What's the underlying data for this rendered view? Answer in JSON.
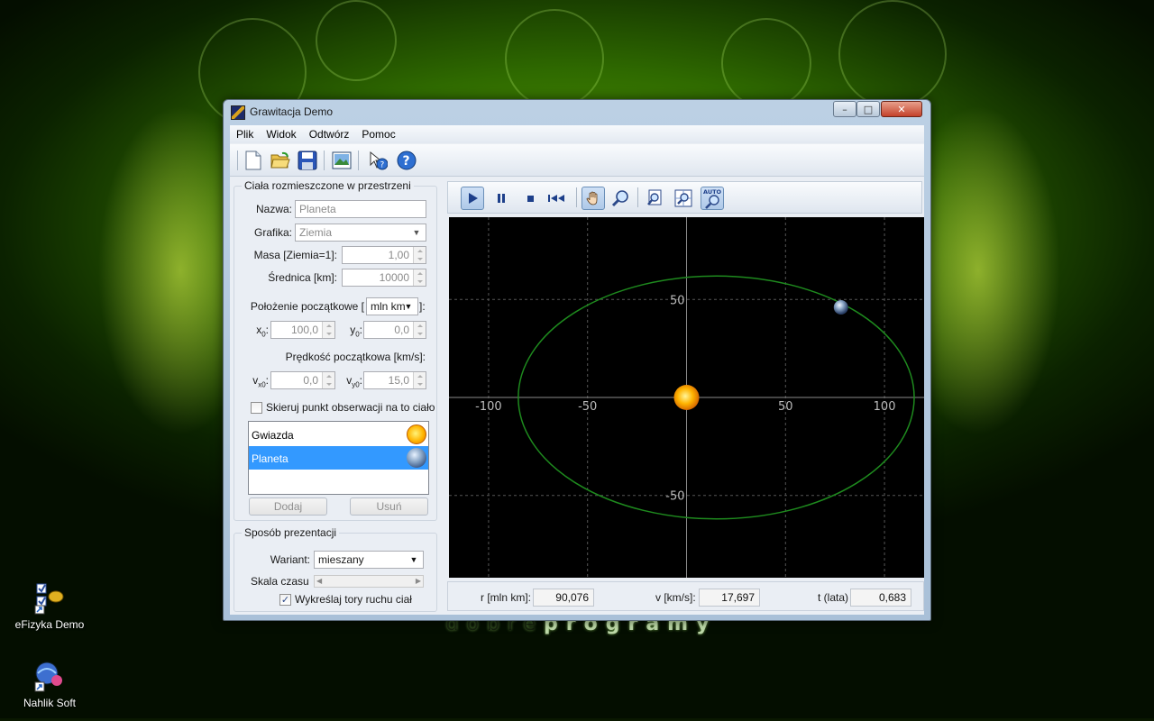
{
  "desktop": {
    "watermark_light": "dobre",
    "watermark_bold": "programy",
    "icons": [
      {
        "label": "eFizyka Demo"
      },
      {
        "label": "Nahlik Soft"
      }
    ]
  },
  "window": {
    "title": "Grawitacja Demo",
    "controls": {
      "min": "–",
      "max": "□",
      "close": "✕"
    }
  },
  "menu": [
    "Plik",
    "Widok",
    "Odtwórz",
    "Pomoc"
  ],
  "bodies_panel": {
    "title": "Ciała rozmieszczone w przestrzeni",
    "name_label": "Nazwa:",
    "name_value": "Planeta",
    "graphic_label": "Grafika:",
    "graphic_value": "Ziemia",
    "mass_label": "Masa [Ziemia=1]:",
    "mass_value": "1,00",
    "diameter_label": "Średnica [km]:",
    "diameter_value": "10000",
    "position_label": "Położenie początkowe [",
    "position_label_end": "]:",
    "position_unit": "mln km",
    "x0_label": "x",
    "x0_sub": "0",
    "x0_value": "100,0",
    "y0_label": "y",
    "y0_sub": "0",
    "y0_value": "0,0",
    "velocity_label": "Prędkość początkowa [km/s]:",
    "vx0_label": "v",
    "vx0_sub": "x0",
    "vx0_value": "0,0",
    "vy0_label": "v",
    "vy0_sub": "y0",
    "vy0_value": "15,0",
    "focus_checkbox_label": "Skieruj punkt obserwacji na to ciało",
    "focus_checked": false,
    "bodies": [
      {
        "name": "Gwiazda",
        "graphic": "sun"
      },
      {
        "name": "Planeta",
        "graphic": "earth",
        "selected": true
      }
    ],
    "add_label": "Dodaj",
    "remove_label": "Usuń"
  },
  "presentation_panel": {
    "title": "Sposób prezentacji",
    "variant_label": "Wariant:",
    "variant_value": "mieszany",
    "timescale_label": "Skala czasu",
    "timescale_level": 0.0,
    "draw_paths_label": "Wykreślaj tory ruchu ciał",
    "draw_paths_checked": true
  },
  "plot": {
    "x_ticks": [
      "-100",
      "-50",
      "50",
      "100"
    ],
    "y_ticks": [
      "50",
      "-50"
    ],
    "x_tick_values": [
      -100,
      -50,
      50,
      100
    ],
    "y_tick_values": [
      50,
      -50
    ],
    "x_range": [
      -120,
      120
    ],
    "y_range": [
      -92,
      92
    ],
    "orbit": {
      "color": "#1e8a1e",
      "semi_x": 100,
      "semi_y": 62,
      "center_x": 15,
      "center_y": 0
    },
    "star": {
      "x": 0,
      "y": 0,
      "color": "#ffb400"
    },
    "planet": {
      "x": 78,
      "y": 46
    }
  },
  "status": {
    "r_label": "r [mln km]:",
    "r_value": "90,076",
    "v_label": "v [km/s]:",
    "v_value": "17,697",
    "t_label": "t (lata)",
    "t_value": "0,683"
  },
  "toolbar_icons": [
    "new-file-icon",
    "open-folder-icon",
    "save-icon",
    "export-image-icon",
    "help-pointer-icon",
    "help-icon"
  ],
  "sim_toolbar": {
    "auto_label": "AUTO",
    "active": [
      "play",
      "pan"
    ]
  }
}
